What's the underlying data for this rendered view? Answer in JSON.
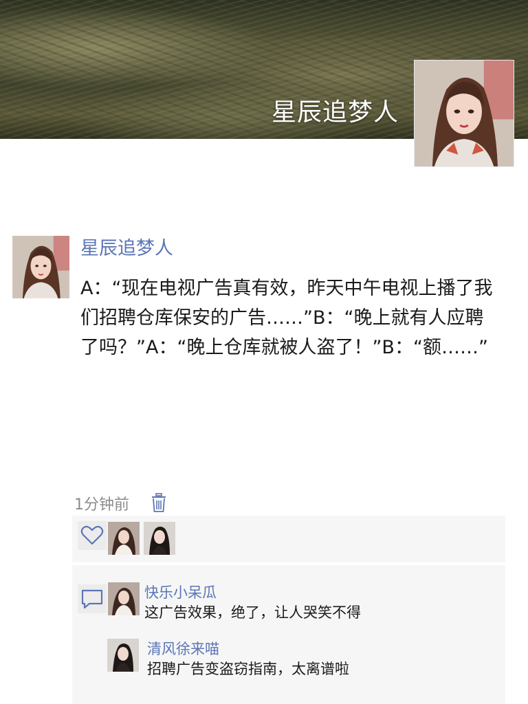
{
  "profile": {
    "cover_title": "星辰追梦人"
  },
  "post": {
    "author": "星辰追梦人",
    "text": "A：“现在电视广告真有效，昨天中午电视上播了我们招聘仓库保安的广告……”B：“晚上就有人应聘了吗？”A：“晚上仓库就被人盗了！”B：“额……”",
    "time": "1分钟前"
  },
  "icons": {
    "delete": "trash-icon",
    "like": "heart-icon",
    "comment": "comment-bubble-icon"
  },
  "likes": {
    "avatars": [
      "avatar-girl-1",
      "avatar-girl-2"
    ]
  },
  "comments": [
    {
      "author": "快乐小呆瓜",
      "text": "这广告效果，绝了，让人哭笑不得"
    },
    {
      "author": "清风徐来喵",
      "text": "招聘广告变盗窃指南，太离谱啦"
    }
  ],
  "colors": {
    "name_blue": "#5b75b6",
    "panel_bg": "#f6f6f6",
    "muted_text": "#8c8c8c"
  }
}
